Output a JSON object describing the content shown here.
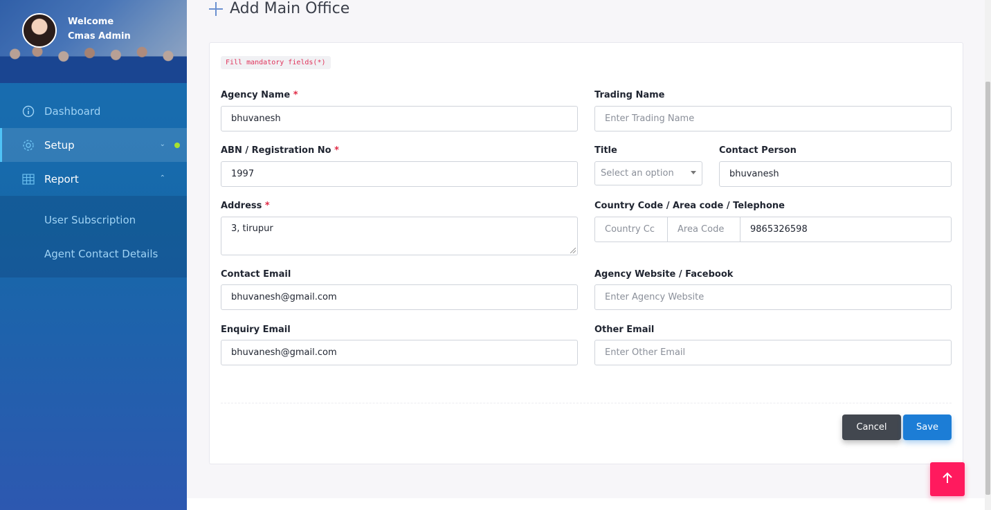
{
  "sidebar": {
    "welcome_line1": "Welcome",
    "welcome_line2": "Cmas Admin",
    "items": [
      {
        "label": "Dashboard",
        "icon": "info-icon"
      },
      {
        "label": "Setup",
        "icon": "gear-icon"
      },
      {
        "label": "Report",
        "icon": "grid-icon"
      }
    ],
    "report_submenu": [
      "User Subscription",
      "Agent Contact Details"
    ]
  },
  "page": {
    "title": "Add Main Office"
  },
  "form": {
    "mandatory_note": "Fill mandatory fields(*)",
    "agency_name": {
      "label": "Agency Name",
      "value": "bhuvanesh"
    },
    "trading_name": {
      "label": "Trading Name",
      "placeholder": "Enter Trading Name"
    },
    "abn": {
      "label": "ABN / Registration No",
      "value": "1997"
    },
    "title": {
      "label": "Title",
      "placeholder": "Select an option"
    },
    "contact_person": {
      "label": "Contact Person",
      "value": "bhuvanesh"
    },
    "address": {
      "label": "Address",
      "value": "3, tirupur"
    },
    "phone": {
      "label": "Country Code / Area code / Telephone",
      "country_placeholder": "Country Cc",
      "area_placeholder": "Area Code",
      "telephone": "9865326598"
    },
    "contact_email": {
      "label": "Contact Email",
      "value": "bhuvanesh@gmail.com"
    },
    "website": {
      "label": "Agency Website / Facebook",
      "placeholder": "Enter Agency Website"
    },
    "enquiry_email": {
      "label": "Enquiry Email",
      "value": "bhuvanesh@gmail.com"
    },
    "other_email": {
      "label": "Other Email",
      "placeholder": "Enter Other Email"
    },
    "required_mark": "*"
  },
  "actions": {
    "cancel": "Cancel",
    "save": "Save"
  },
  "colors": {
    "sidebar": "#1a6fb3",
    "save": "#1c7dd6",
    "cancel": "#42474f",
    "scroll_top": "#ff1a5e",
    "required": "#e02a45"
  }
}
